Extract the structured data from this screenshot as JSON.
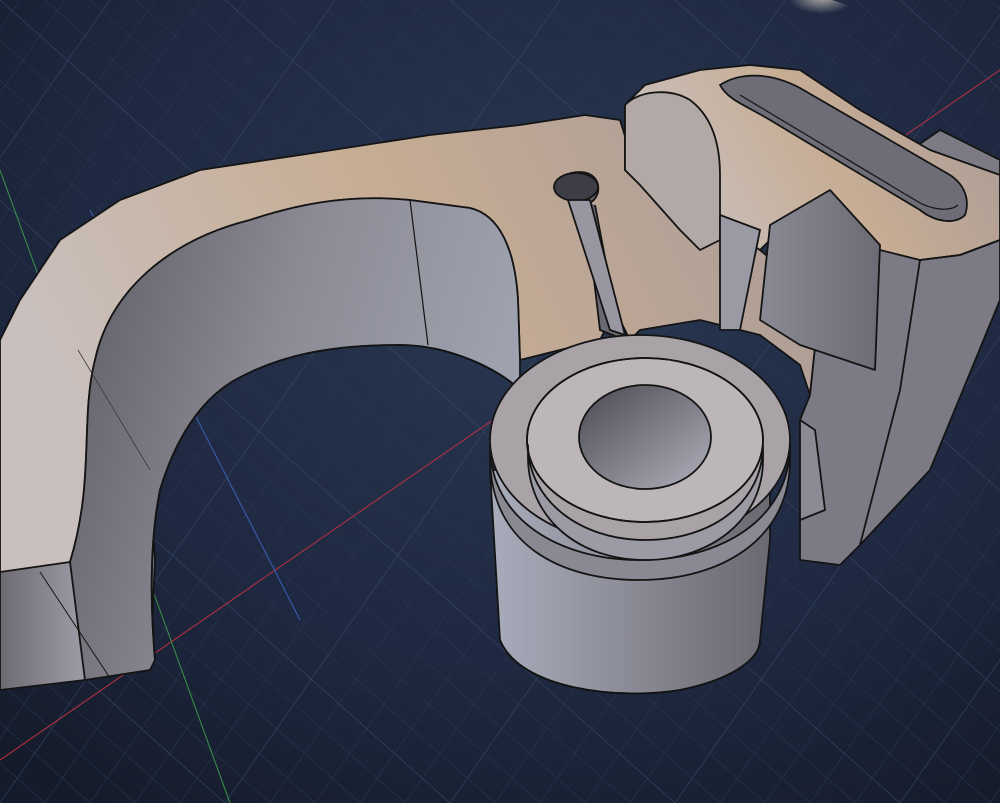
{
  "viewport": {
    "background_color": "#1b2436",
    "grid_color": "#3a4a6a",
    "grid_fine_color": "#2a3650",
    "axis_x_color": "#b03040",
    "axis_y_color": "#3a8a4a",
    "axis_z_color": "#3a5ab0",
    "model_face_color": "#b9aca4",
    "model_side_color": "#8e8c96",
    "edge_color": "#141414",
    "highlight_color": "#f2e2c8"
  }
}
